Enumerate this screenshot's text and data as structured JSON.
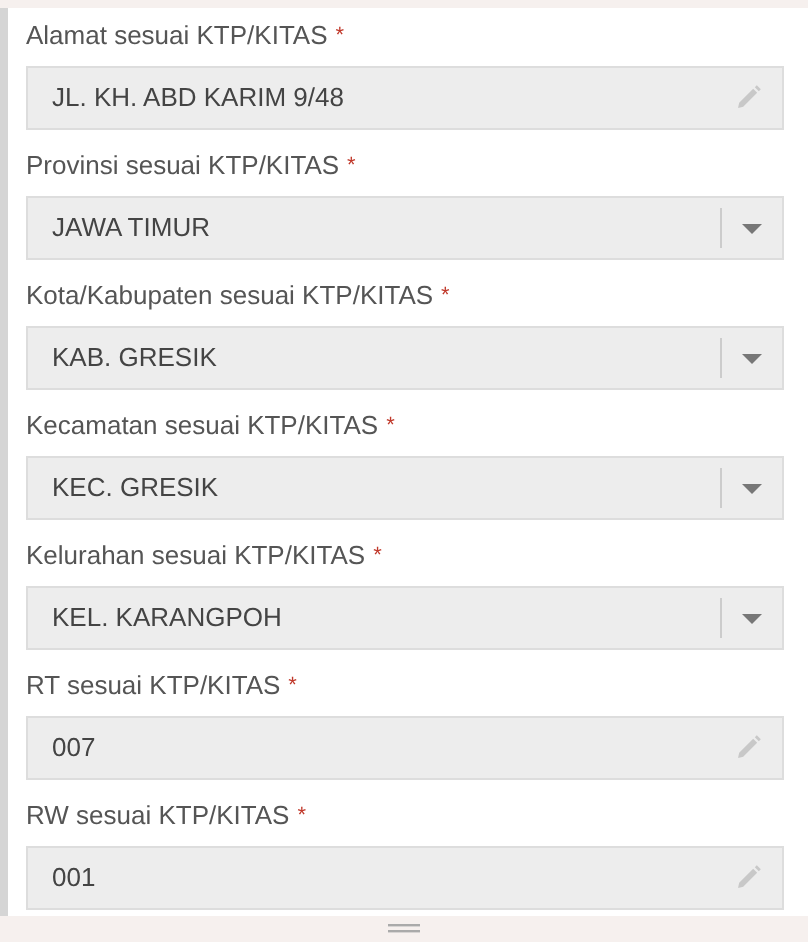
{
  "fields": [
    {
      "label": "Alamat sesuai KTP/KITAS",
      "required_mark": "*",
      "kind": "text",
      "value": "JL. KH. ABD KARIM 9/48"
    },
    {
      "label": "Provinsi sesuai KTP/KITAS",
      "required_mark": "*",
      "kind": "select",
      "value": "JAWA TIMUR"
    },
    {
      "label": "Kota/Kabupaten sesuai KTP/KITAS",
      "required_mark": "*",
      "kind": "select",
      "value": "KAB. GRESIK"
    },
    {
      "label": "Kecamatan sesuai KTP/KITAS",
      "required_mark": "*",
      "kind": "select",
      "value": "KEC. GRESIK"
    },
    {
      "label": "Kelurahan sesuai KTP/KITAS",
      "required_mark": "*",
      "kind": "select",
      "value": "KEL. KARANGPOH"
    },
    {
      "label": "RT sesuai KTP/KITAS",
      "required_mark": "*",
      "kind": "text",
      "value": "007"
    },
    {
      "label": "RW sesuai KTP/KITAS",
      "required_mark": "*",
      "kind": "text",
      "value": "001"
    }
  ]
}
